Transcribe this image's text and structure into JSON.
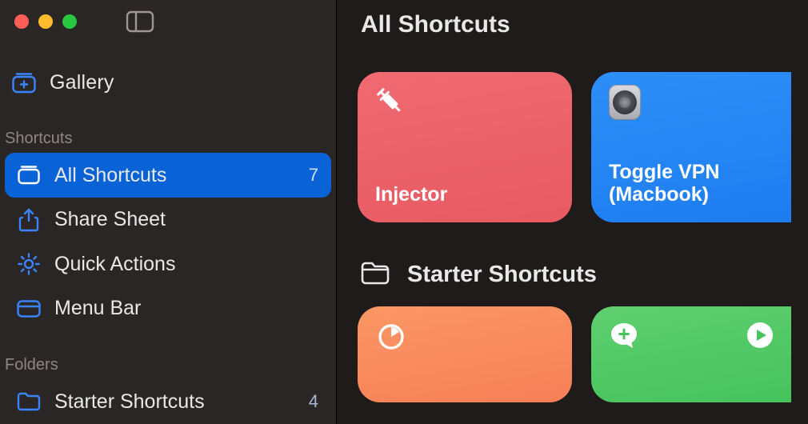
{
  "page": {
    "title": "All Shortcuts"
  },
  "sidebar": {
    "gallery": {
      "label": "Gallery"
    },
    "section_shortcuts": "Shortcuts",
    "section_folders": "Folders",
    "items": {
      "all": {
        "label": "All Shortcuts",
        "count": "7"
      },
      "share": {
        "label": "Share Sheet"
      },
      "quick": {
        "label": "Quick Actions"
      },
      "menubar": {
        "label": "Menu Bar"
      }
    },
    "folders": {
      "starter": {
        "label": "Starter Shortcuts",
        "count": "4"
      }
    }
  },
  "groups": {
    "starter": {
      "label": "Starter Shortcuts"
    }
  },
  "tiles": {
    "injector": {
      "label": "Injector"
    },
    "togglevpn": {
      "label": "Toggle VPN (Macbook)"
    }
  }
}
